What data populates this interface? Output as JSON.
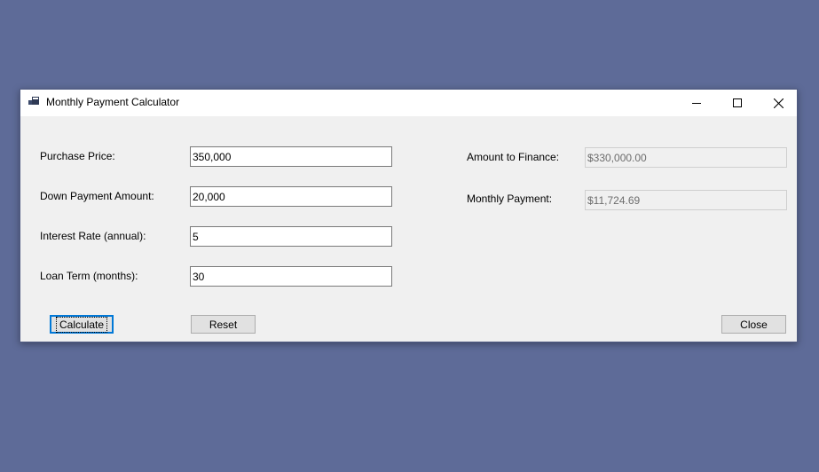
{
  "window": {
    "title": "Monthly Payment Calculator",
    "app_icon": "app-window-icon",
    "controls": [
      "minimize-icon",
      "maximize-icon",
      "close-icon"
    ]
  },
  "form": {
    "purchase_price": {
      "label": "Purchase Price:",
      "value": "350,000"
    },
    "down_payment": {
      "label": "Down Payment Amount:",
      "value": "20,000"
    },
    "interest_rate": {
      "label": "Interest Rate (annual):",
      "value": "5"
    },
    "loan_term": {
      "label": "Loan Term (months):",
      "value": "30"
    }
  },
  "results": {
    "amount_to_finance": {
      "label": "Amount to Finance:",
      "value": "$330,000.00"
    },
    "monthly_payment": {
      "label": "Monthly Payment:",
      "value": "$11,724.69"
    }
  },
  "buttons": {
    "calculate": "Calculate",
    "reset": "Reset",
    "close": "Close"
  },
  "colors": {
    "desktop": "#5e6b98",
    "window_bg": "#f0f0f0",
    "accent": "#0078d7"
  }
}
